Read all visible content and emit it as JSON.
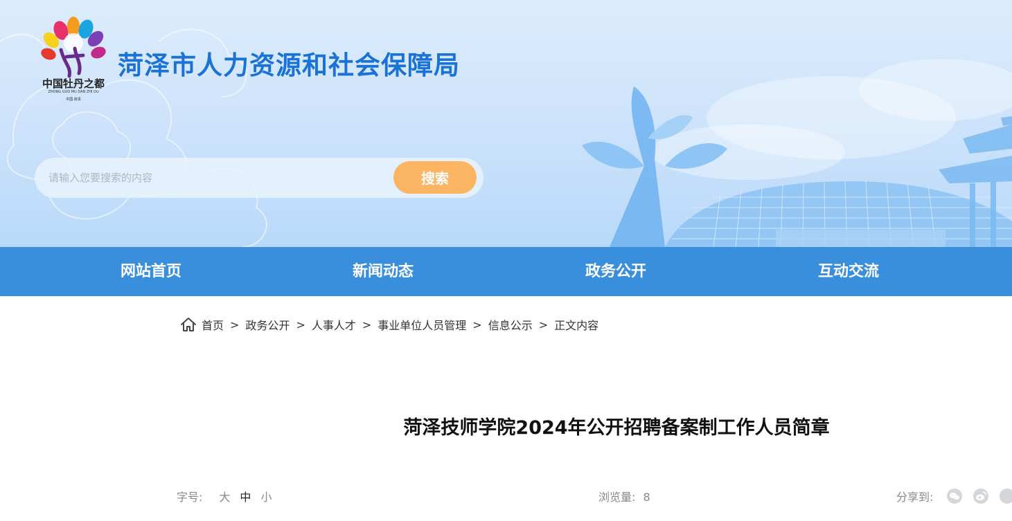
{
  "header": {
    "site_title": "菏泽市人力资源和社会保障局",
    "logo_caption": "中国牡丹之都",
    "logo_subcaption": "ZHONG GUO MU DAN ZHI DU",
    "logo_small": "中国·菏泽"
  },
  "search": {
    "placeholder": "请输入您要搜索的内容",
    "button_label": "搜索"
  },
  "nav": {
    "items": [
      {
        "label": "网站首页"
      },
      {
        "label": "新闻动态"
      },
      {
        "label": "政务公开"
      },
      {
        "label": "互动交流"
      }
    ]
  },
  "breadcrumb": {
    "items": [
      "首页",
      "政务公开",
      "人事人才",
      "事业单位人员管理",
      "信息公示",
      "正文内容"
    ],
    "separator": ">"
  },
  "article": {
    "title": "菏泽技师学院2024年公开招聘备案制工作人员简章",
    "font_size_label": "字号:",
    "font_sizes": [
      "大",
      "中",
      "小"
    ],
    "views_label": "浏览量:",
    "views": "8",
    "share_label": "分享到:"
  },
  "icons": {
    "home": "home-icon",
    "wechat": "wechat-icon",
    "weibo": "weibo-icon"
  },
  "colors": {
    "title_blue": "#1a72d6",
    "nav_blue": "#3a8fdc",
    "search_orange": "#fcb563"
  }
}
